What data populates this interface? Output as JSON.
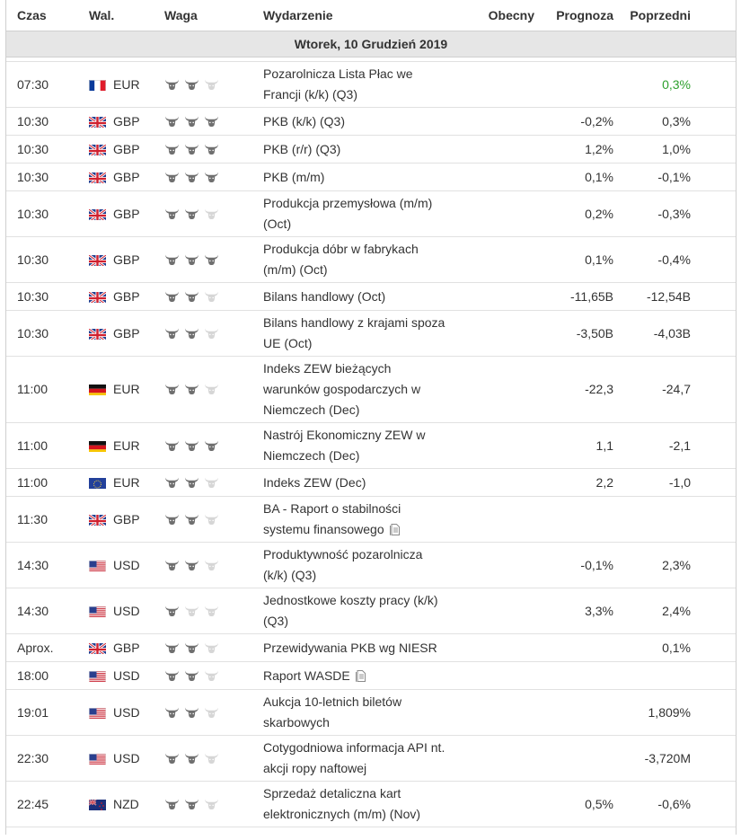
{
  "headers": {
    "time": "Czas",
    "currency": "Wal.",
    "weight": "Waga",
    "event": "Wydarzenie",
    "actual": "Obecny",
    "forecast": "Prognoza",
    "previous": "Poprzedni"
  },
  "day_label": "Wtorek, 10 Grudzień 2019",
  "colors": {
    "bull_active": "#6f6f6f",
    "bull_inactive": "#d6d6d6",
    "green_value": "#2ea02e",
    "day_bg": "#e6e6e6"
  },
  "events": [
    {
      "time": "07:30",
      "flag": "fr",
      "currency": "EUR",
      "importance": 2,
      "lines": [
        "Pozarolnicza Lista Płac we",
        "Francji (k/k) (Q3)"
      ],
      "doc": false,
      "actual": "",
      "forecast": "",
      "previous": "0,3%",
      "previous_color": "green"
    },
    {
      "time": "10:30",
      "flag": "gb",
      "currency": "GBP",
      "importance": 3,
      "lines": [
        "PKB (k/k) (Q3)"
      ],
      "doc": false,
      "actual": "",
      "forecast": "-0,2%",
      "previous": "0,3%"
    },
    {
      "time": "10:30",
      "flag": "gb",
      "currency": "GBP",
      "importance": 3,
      "lines": [
        "PKB (r/r) (Q3)"
      ],
      "doc": false,
      "actual": "",
      "forecast": "1,2%",
      "previous": "1,0%"
    },
    {
      "time": "10:30",
      "flag": "gb",
      "currency": "GBP",
      "importance": 3,
      "lines": [
        "PKB (m/m)"
      ],
      "doc": false,
      "actual": "",
      "forecast": "0,1%",
      "previous": "-0,1%"
    },
    {
      "time": "10:30",
      "flag": "gb",
      "currency": "GBP",
      "importance": 2,
      "lines": [
        "Produkcja przemysłowa (m/m)",
        "(Oct)"
      ],
      "doc": false,
      "actual": "",
      "forecast": "0,2%",
      "previous": "-0,3%"
    },
    {
      "time": "10:30",
      "flag": "gb",
      "currency": "GBP",
      "importance": 3,
      "lines": [
        "Produkcja dóbr w fabrykach",
        "(m/m) (Oct)"
      ],
      "doc": false,
      "actual": "",
      "forecast": "0,1%",
      "previous": "-0,4%"
    },
    {
      "time": "10:30",
      "flag": "gb",
      "currency": "GBP",
      "importance": 2,
      "lines": [
        "Bilans handlowy (Oct)"
      ],
      "doc": false,
      "actual": "",
      "forecast": "-11,65B",
      "previous": "-12,54B"
    },
    {
      "time": "10:30",
      "flag": "gb",
      "currency": "GBP",
      "importance": 2,
      "lines": [
        "Bilans handlowy z krajami spoza",
        "UE (Oct)"
      ],
      "doc": false,
      "actual": "",
      "forecast": "-3,50B",
      "previous": "-4,03B"
    },
    {
      "time": "11:00",
      "flag": "de",
      "currency": "EUR",
      "importance": 2,
      "lines": [
        "Indeks ZEW bieżących",
        "warunków gospodarczych w",
        "Niemczech (Dec)"
      ],
      "doc": false,
      "actual": "",
      "forecast": "-22,3",
      "previous": "-24,7"
    },
    {
      "time": "11:00",
      "flag": "de",
      "currency": "EUR",
      "importance": 3,
      "lines": [
        "Nastrój Ekonomiczny ZEW w",
        "Niemczech (Dec)"
      ],
      "doc": false,
      "actual": "",
      "forecast": "1,1",
      "previous": "-2,1"
    },
    {
      "time": "11:00",
      "flag": "eu",
      "currency": "EUR",
      "importance": 2,
      "lines": [
        "Indeks ZEW (Dec)"
      ],
      "doc": false,
      "actual": "",
      "forecast": "2,2",
      "previous": "-1,0"
    },
    {
      "time": "11:30",
      "flag": "gb",
      "currency": "GBP",
      "importance": 2,
      "lines": [
        "BA - Raport o stabilności",
        "systemu finansowego"
      ],
      "doc": true,
      "actual": "",
      "forecast": "",
      "previous": ""
    },
    {
      "time": "14:30",
      "flag": "us",
      "currency": "USD",
      "importance": 2,
      "lines": [
        "Produktywność pozarolnicza",
        "(k/k) (Q3)"
      ],
      "doc": false,
      "actual": "",
      "forecast": "-0,1%",
      "previous": "2,3%"
    },
    {
      "time": "14:30",
      "flag": "us",
      "currency": "USD",
      "importance": 1,
      "lines": [
        "Jednostkowe koszty pracy (k/k)",
        "(Q3)"
      ],
      "doc": false,
      "actual": "",
      "forecast": "3,3%",
      "previous": "2,4%"
    },
    {
      "time": "Aprox.",
      "flag": "gb",
      "currency": "GBP",
      "importance": 2,
      "lines": [
        "Przewidywania PKB wg NIESR"
      ],
      "doc": false,
      "actual": "",
      "forecast": "",
      "previous": "0,1%"
    },
    {
      "time": "18:00",
      "flag": "us",
      "currency": "USD",
      "importance": 2,
      "lines": [
        "Raport WASDE"
      ],
      "doc": true,
      "actual": "",
      "forecast": "",
      "previous": ""
    },
    {
      "time": "19:01",
      "flag": "us",
      "currency": "USD",
      "importance": 2,
      "lines": [
        "Aukcja 10-letnich biletów",
        "skarbowych"
      ],
      "doc": false,
      "actual": "",
      "forecast": "",
      "previous": "1,809%"
    },
    {
      "time": "22:30",
      "flag": "us",
      "currency": "USD",
      "importance": 2,
      "lines": [
        "Cotygodniowa informacja API nt.",
        "akcji ropy naftowej"
      ],
      "doc": false,
      "actual": "",
      "forecast": "",
      "previous": "-3,720M"
    },
    {
      "time": "22:45",
      "flag": "nz",
      "currency": "NZD",
      "importance": 2,
      "lines": [
        "Sprzedaż detaliczna kart",
        "elektronicznych (m/m) (Nov)"
      ],
      "doc": false,
      "actual": "",
      "forecast": "0,5%",
      "previous": "-0,6%"
    }
  ]
}
